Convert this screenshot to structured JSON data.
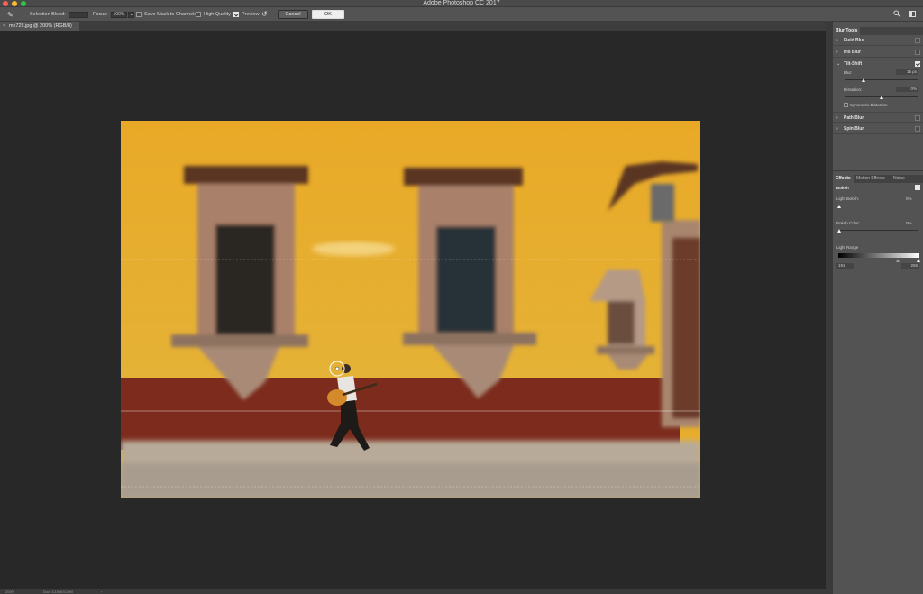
{
  "window": {
    "title": "Adobe Photoshop CC 2017"
  },
  "options_bar": {
    "selection_bleed_label": "Selection Bleed:",
    "focus_label": "Focus:",
    "focus_value": "100%",
    "save_mask_label": "Save Mask to Channels",
    "save_mask_checked": false,
    "high_quality_label": "High Quality",
    "high_quality_checked": false,
    "preview_label": "Preview",
    "preview_checked": true,
    "cancel_label": "Cancel",
    "ok_label": "OK"
  },
  "document": {
    "tab_title": "mx725.jpg @ 200% (RGB/8)",
    "close_glyph": "×"
  },
  "status_bar": {
    "zoom": "200%",
    "doc_info": "Doc: 3.19M/3.19M",
    "arrow": "›"
  },
  "blur_tools": {
    "panel_title": "Blur Tools",
    "items": [
      {
        "label": "Field Blur",
        "arrow": "›",
        "checked": false
      },
      {
        "label": "Iris Blur",
        "arrow": "›",
        "checked": false
      },
      {
        "label": "Tilt-Shift",
        "arrow": "⌄",
        "checked": true
      },
      {
        "label": "Path Blur",
        "arrow": "›",
        "checked": false
      },
      {
        "label": "Spin Blur",
        "arrow": "›",
        "checked": false
      }
    ],
    "tilt_shift": {
      "blur_label": "Blur:",
      "blur_value": "15 px",
      "blur_level": 0.25,
      "distortion_label": "Distortion:",
      "distortion_value": "0%",
      "distortion_level": 0.5,
      "symmetric_label": "Symmetric Distortion",
      "symmetric_checked": false
    }
  },
  "effects_panel": {
    "tabs": [
      "Effects",
      "Motion Effects",
      "Noise"
    ],
    "bokeh_label": "Bokeh",
    "bokeh_checked": true,
    "light_bokeh_label": "Light Bokeh:",
    "light_bokeh_value": "0%",
    "bokeh_color_label": "Bokeh Color:",
    "bokeh_color_value": "0%",
    "light_range_label": "Light Range",
    "range_low": "191",
    "range_high": "255"
  }
}
